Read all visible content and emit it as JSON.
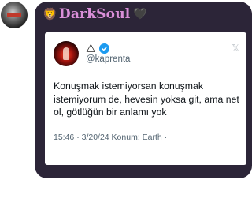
{
  "chat": {
    "sender_avatar_icon": "user-avatar-icon",
    "sender_name": "DarkSoul",
    "sender_prefix_emoji": "🦁",
    "sender_suffix_emoji": "🖤"
  },
  "tweet": {
    "display_icon": "warning-triangle-icon",
    "verified_icon": "verified-badge-icon",
    "handle": "@kaprenta",
    "close_icon": "x-logo-icon",
    "text": "Konuşmak istemiyorsan konuşmak istemiyorum de, hevesin yoksa git, ama net ol, götlüğün bir anlamı yok",
    "meta": "15:46 · 3/20/24 Konum: Earth ·"
  },
  "colors": {
    "bubble_bg": "#2c2538",
    "sender_name": "#d98fd8",
    "verified": "#1d9bf0"
  }
}
